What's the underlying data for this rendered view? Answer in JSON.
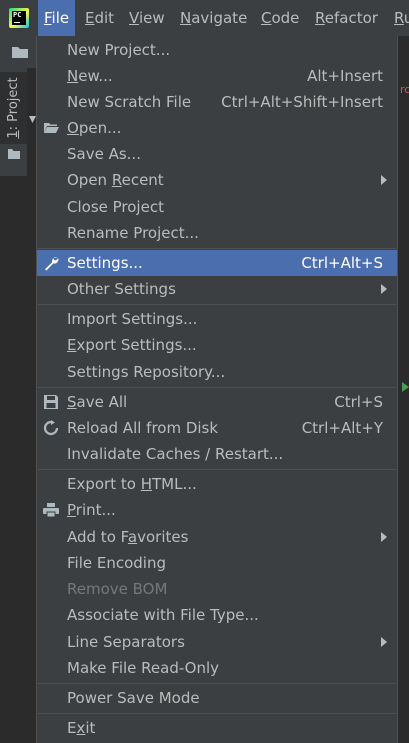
{
  "menubar": {
    "logo_text": "PC",
    "items": [
      {
        "pre": "",
        "ul": "F",
        "post": "ile"
      },
      {
        "pre": "",
        "ul": "E",
        "post": "dit"
      },
      {
        "pre": "",
        "ul": "V",
        "post": "iew"
      },
      {
        "pre": "",
        "ul": "N",
        "post": "avigate"
      },
      {
        "pre": "",
        "ul": "C",
        "post": "ode"
      },
      {
        "pre": "",
        "ul": "R",
        "post": "efactor"
      },
      {
        "pre": "",
        "ul": "R",
        "post": "u"
      }
    ]
  },
  "sidebar": {
    "project_tab": {
      "ul": "1",
      "post": ": Project"
    }
  },
  "editor": {
    "right_hint": "rc"
  },
  "file_menu": {
    "new_project": "New Project...",
    "new": {
      "ul": "N",
      "post": "ew...",
      "shortcut": "Alt+Insert"
    },
    "new_scratch": {
      "label": "New Scratch File",
      "shortcut": "Ctrl+Alt+Shift+Insert"
    },
    "open": {
      "ul": "O",
      "post": "pen..."
    },
    "save_as": "Save As...",
    "open_recent": {
      "pre": "Open ",
      "ul": "R",
      "post": "ecent"
    },
    "close_project": "Close Project",
    "rename_project": "Rename Project...",
    "settings": {
      "label": "Settings...",
      "shortcut": "Ctrl+Alt+S"
    },
    "other_settings": "Other Settings",
    "import_settings": "Import Settings...",
    "export_settings": {
      "ul": "E",
      "post": "xport Settings..."
    },
    "settings_repository": "Settings Repository...",
    "save_all": {
      "ul": "S",
      "post": "ave All",
      "shortcut": "Ctrl+S"
    },
    "reload_all": {
      "label": "Reload All from Disk",
      "shortcut": "Ctrl+Alt+Y"
    },
    "invalidate_caches": "Invalidate Caches / Restart...",
    "export_html": {
      "pre": "Export to ",
      "ul": "H",
      "post": "TML..."
    },
    "print": {
      "ul": "P",
      "post": "rint..."
    },
    "add_favorites": {
      "pre": "Add to F",
      "ul": "a",
      "post": "vorites"
    },
    "file_encoding": "File Encoding",
    "remove_bom": "Remove BOM",
    "associate_file_type": "Associate with File Type...",
    "line_separators": "Line Separators",
    "make_read_only": "Make File Read-Only",
    "power_save": "Power Save Mode",
    "exit": {
      "pre": "E",
      "ul": "x",
      "post": "it"
    }
  },
  "colors": {
    "menu_bg": "#3c3f41",
    "highlight": "#4b6eaf",
    "text": "#bbbbbb",
    "disabled_text": "#777777",
    "separator": "#515151"
  }
}
